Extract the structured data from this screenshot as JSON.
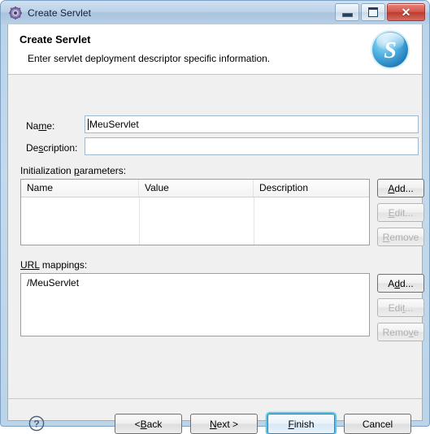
{
  "window": {
    "title": "Create Servlet",
    "icon": "gear-icon",
    "controls": {
      "minimize": "Minimize",
      "maximize": "Maximize",
      "close": "Close",
      "close_glyph": "✕"
    }
  },
  "banner": {
    "title": "Create Servlet",
    "subtitle": "Enter servlet deployment descriptor specific information.",
    "logo_letter": "S",
    "logo_color": "#2e9fd8"
  },
  "form": {
    "name_label_before": "Na",
    "name_label_mnemonic": "m",
    "name_label_after": "e:",
    "name_value": "MeuServlet",
    "name_placeholder": "",
    "description_label_before": "De",
    "description_label_mnemonic": "s",
    "description_label_after": "cription:",
    "description_value": "",
    "description_placeholder": ""
  },
  "init_params": {
    "label_before": "Initialization ",
    "label_mnemonic": "p",
    "label_after": "arameters:",
    "columns": [
      "Name",
      "Value",
      "Description"
    ],
    "rows": [],
    "buttons": [
      {
        "text_before": "",
        "mnemonic": "A",
        "text_after": "dd...",
        "enabled": true,
        "name": "add"
      },
      {
        "text_before": "",
        "mnemonic": "E",
        "text_after": "dit...",
        "enabled": false,
        "name": "edit"
      },
      {
        "text_before": "",
        "mnemonic": "R",
        "text_after": "emove",
        "enabled": false,
        "name": "remove"
      }
    ]
  },
  "url_mappings": {
    "label_before": "",
    "label_mnemonic": "URL",
    "label_after": " mappings:",
    "items": [
      "/MeuServlet"
    ],
    "buttons": [
      {
        "text_before": "A",
        "mnemonic": "d",
        "text_after": "d...",
        "enabled": true,
        "name": "add"
      },
      {
        "text_before": "Edi",
        "mnemonic": "t",
        "text_after": "...",
        "enabled": false,
        "name": "edit"
      },
      {
        "text_before": "Remo",
        "mnemonic": "v",
        "text_after": "e",
        "enabled": false,
        "name": "remove"
      }
    ]
  },
  "footer": {
    "help_icon": "question-mark-icon",
    "help_glyph": "?",
    "buttons": [
      {
        "text_before": "< ",
        "mnemonic": "B",
        "text_after": "ack",
        "default": false,
        "name": "back"
      },
      {
        "text_before": "",
        "mnemonic": "N",
        "text_after": "ext >",
        "default": false,
        "name": "next"
      },
      {
        "text_before": "",
        "mnemonic": "F",
        "text_after": "inish",
        "default": true,
        "name": "finish"
      },
      {
        "text_before": "Cancel",
        "mnemonic": "",
        "text_after": "",
        "default": false,
        "name": "cancel"
      }
    ]
  }
}
